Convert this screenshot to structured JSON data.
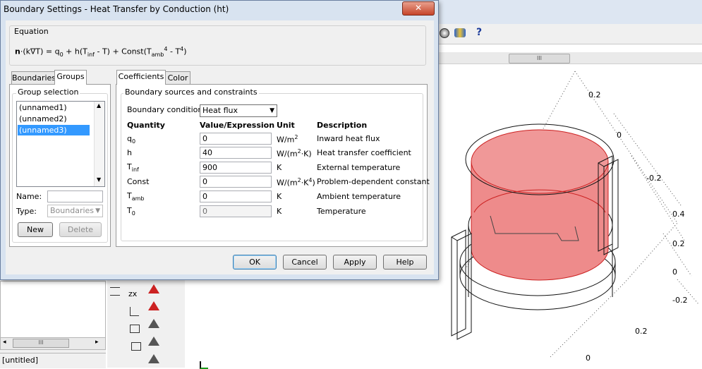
{
  "dialog": {
    "title": "Boundary Settings - Heat Transfer by Conduction (ht)",
    "close_label": "✕",
    "equation_group_label": "Equation",
    "equation": {
      "n": "n",
      "p1": "·(k∇T) = q",
      "s0": "0",
      "p2": " + h(T",
      "sinf": "inf",
      "p3": " - T) + Const(T",
      "samb": "amb",
      "sup4a": "4",
      "p4": " - T",
      "sup4b": "4",
      "p5": ")"
    },
    "left_tabs": [
      "Boundaries",
      "Groups"
    ],
    "group_selection_label": "Group selection",
    "groups": [
      "(unnamed1)",
      "(unnamed2)",
      "(unnamed3)"
    ],
    "name_label": "Name:",
    "name_value": "",
    "type_label": "Type:",
    "type_value": "Boundaries",
    "new_button": "New",
    "delete_button": "Delete",
    "right_tabs": [
      "Coefficients",
      "Color"
    ],
    "sources_label": "Boundary sources and constraints",
    "boundary_condition_label": "Boundary condition:",
    "boundary_condition_value": "Heat flux",
    "columns": [
      "Quantity",
      "Value/Expression",
      "Unit",
      "Description"
    ],
    "rows": [
      {
        "q": "q",
        "qsub": "0",
        "value": "0",
        "unit": "W/m",
        "usup": "2",
        "utail": "",
        "desc": "Inward heat flux",
        "disabled": false
      },
      {
        "q": "h",
        "qsub": "",
        "value": "40",
        "unit": "W/(m",
        "usup": "2",
        "utail": "·K)",
        "desc": "Heat transfer coefficient",
        "disabled": false
      },
      {
        "q": "T",
        "qsub": "inf",
        "value": "900",
        "unit": "K",
        "usup": "",
        "utail": "",
        "desc": "External temperature",
        "disabled": false
      },
      {
        "q": "Const",
        "qsub": "",
        "value": "0",
        "unit": "W/(m",
        "usup": "2",
        "utail": "·K",
        "usup2": "4",
        "utail2": ")",
        "desc": "Problem-dependent constant",
        "disabled": false
      },
      {
        "q": "T",
        "qsub": "amb",
        "value": "0",
        "unit": "K",
        "usup": "",
        "utail": "",
        "desc": "Ambient temperature",
        "disabled": false
      },
      {
        "q": "T",
        "qsub": "0",
        "value": "0",
        "unit": "K",
        "usup": "",
        "utail": "",
        "desc": "Temperature",
        "disabled": true
      }
    ],
    "ok_button": "OK",
    "cancel_button": "Cancel",
    "apply_button": "Apply",
    "help_button": "Help"
  },
  "background": {
    "toolbar_help": "?",
    "scroll_grip": "III",
    "hscroll_grip": "III",
    "status_text": "[untitled]",
    "axis_labels": [
      "0.2",
      "0",
      "-0.2",
      "0.4",
      "0.2",
      "0",
      "-0.2",
      "0.2",
      "0"
    ]
  },
  "colors": {
    "accent_selection": "#3399ff",
    "object_fill": "#ee8b8b",
    "dialog_frame": "#d8e3f0"
  }
}
